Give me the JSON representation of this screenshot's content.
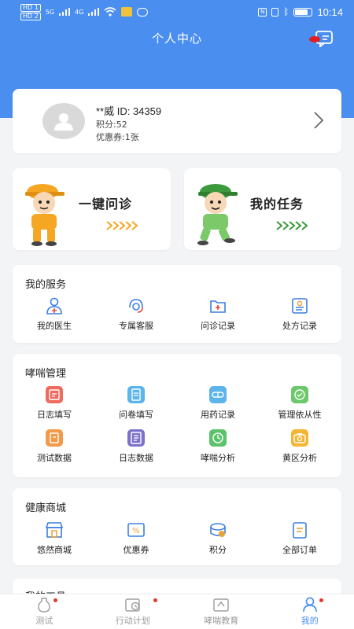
{
  "status_bar": {
    "sim1": "HD 1",
    "sim2": "HD 2",
    "network": "5G",
    "network2": "4G",
    "battery_level": 0.8,
    "time": "10:14"
  },
  "header": {
    "title": "个人中心",
    "message_icon": "message-icon"
  },
  "profile": {
    "name": "**威  ID: 34359",
    "points": "积分:52",
    "coupons": "优惠券:1张"
  },
  "features": [
    {
      "label": "一键问诊"
    },
    {
      "label": "我的任务"
    }
  ],
  "services": {
    "title": "我的服务",
    "items": [
      {
        "label": "我的医生",
        "icon": "doctor-icon"
      },
      {
        "label": "专属客服",
        "icon": "customer-service-icon"
      },
      {
        "label": "问诊记录",
        "icon": "consult-record-icon"
      },
      {
        "label": "处方记录",
        "icon": "prescription-icon"
      }
    ]
  },
  "asthma": {
    "title": "哮喘管理",
    "items": [
      {
        "label": "日志填写",
        "icon": "diary-icon",
        "color": "#f06b5e"
      },
      {
        "label": "问卷填写",
        "icon": "questionnaire-icon",
        "color": "#5bb5ea"
      },
      {
        "label": "用药记录",
        "icon": "medication-icon",
        "color": "#5bb5ea"
      },
      {
        "label": "管理依从性",
        "icon": "compliance-icon",
        "color": "#6cc86a"
      },
      {
        "label": "测试数据",
        "icon": "test-data-icon",
        "color": "#f39a4a"
      },
      {
        "label": "日志数据",
        "icon": "diary-data-icon",
        "color": "#7b73c9"
      },
      {
        "label": "哮喘分析",
        "icon": "asthma-analysis-icon",
        "color": "#5cc36a"
      },
      {
        "label": "黄区分析",
        "icon": "yellow-zone-icon",
        "color": "#f5b534"
      }
    ]
  },
  "mall": {
    "title": "健康商城",
    "items": [
      {
        "label": "悠然商城",
        "icon": "shop-icon"
      },
      {
        "label": "优惠券",
        "icon": "coupon-icon"
      },
      {
        "label": "积分",
        "icon": "points-icon"
      },
      {
        "label": "全部订单",
        "icon": "orders-icon"
      }
    ]
  },
  "next_section": {
    "title": "我的工具"
  },
  "tabs": [
    {
      "label": "测试",
      "icon": "test-tab-icon",
      "badge": true
    },
    {
      "label": "行动计划",
      "icon": "plan-tab-icon",
      "badge": true
    },
    {
      "label": "哮喘教育",
      "icon": "education-tab-icon",
      "badge": false
    },
    {
      "label": "我的",
      "icon": "profile-tab-icon",
      "badge": true,
      "active": true
    }
  ],
  "colors": {
    "primary": "#4a8ff0",
    "badge": "#e03a2a",
    "orange_arrow": "#f5a623",
    "green_arrow": "#3c9a3c"
  }
}
